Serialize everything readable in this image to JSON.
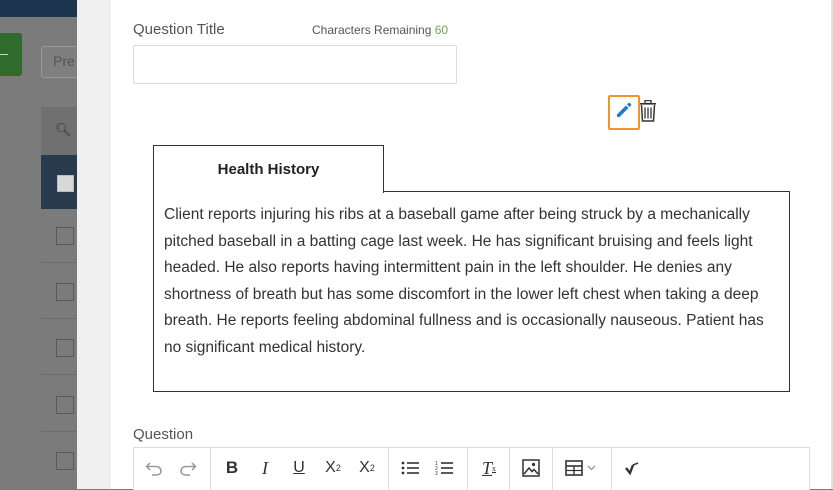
{
  "background": {
    "search_placeholder": "Pre"
  },
  "form": {
    "question_title_label": "Question Title",
    "characters_remaining_label": "Characters Remaining",
    "characters_remaining_value": "60",
    "question_title_value": ""
  },
  "tab": {
    "label": "Health History"
  },
  "content": {
    "text": "Client reports injuring his ribs at a baseball game after being struck by a mechanically pitched baseball in a batting cage last week. He has significant bruising and feels light headed. He also reports having intermittent pain in the left shoulder. He denies any shortness of breath but has some discomfort in the lower left chest when taking a deep breath. He reports feeling abdominal fullness and is occasionally nauseous. Patient has no significant medical history."
  },
  "question": {
    "label": "Question"
  },
  "colors": {
    "accent_orange": "#f0952e",
    "edit_icon_blue": "#1d78d6",
    "remaining_green": "#6aa84f"
  },
  "toolbar_icons": [
    "undo-icon",
    "redo-icon",
    "bold-icon",
    "italic-icon",
    "underline-icon",
    "superscript-icon",
    "subscript-icon",
    "bullet-list-icon",
    "numbered-list-icon",
    "clear-format-icon",
    "image-icon",
    "table-icon",
    "checkmark-icon"
  ]
}
